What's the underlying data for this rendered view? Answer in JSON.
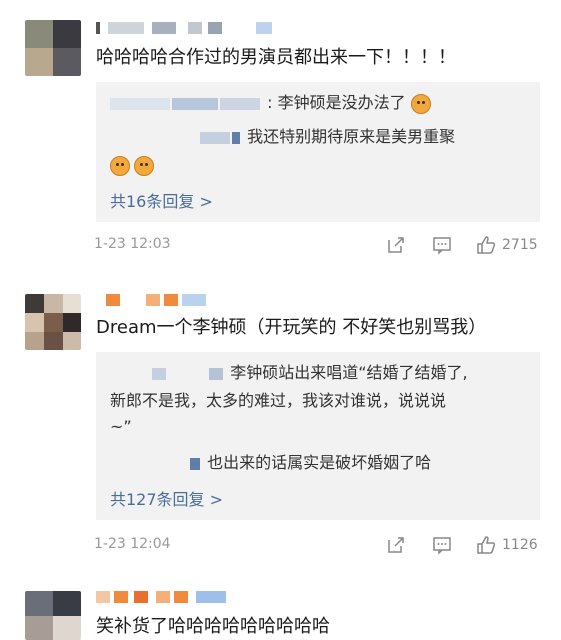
{
  "comments": [
    {
      "text": "哈哈哈哈合作过的男演员都出来一下！！！！",
      "replies": [
        "李钟硕是没办法了",
        "我还特别期待原来是美男重聚"
      ],
      "reply_more": "共16条回复 >",
      "timestamp": "1-23 12:03",
      "likes": "2715"
    },
    {
      "text": "Dream一个李钟硕（开玩笑的 不好笑也别骂我）",
      "replies": [
        "李钟硕站出来唱道“结婚了结婚了,",
        "新郎不是我，太多的难过，我该对谁说，说说说",
        "~”",
        "也出来的话属实是破坏婚姻了哈"
      ],
      "reply_more": "共127条回复 >",
      "timestamp": "1-23 12:04",
      "likes": "1126"
    },
    {
      "text": "笑补货了哈哈哈哈哈哈哈哈哈"
    }
  ],
  "icons": {
    "share": "share-icon",
    "comment": "comment-icon",
    "like": "like-icon",
    "emoji": "laughing-emoji-icon"
  },
  "colors": {
    "link": "#4a6c99",
    "reply_bg": "#f2f2f2",
    "meta": "#999999"
  }
}
